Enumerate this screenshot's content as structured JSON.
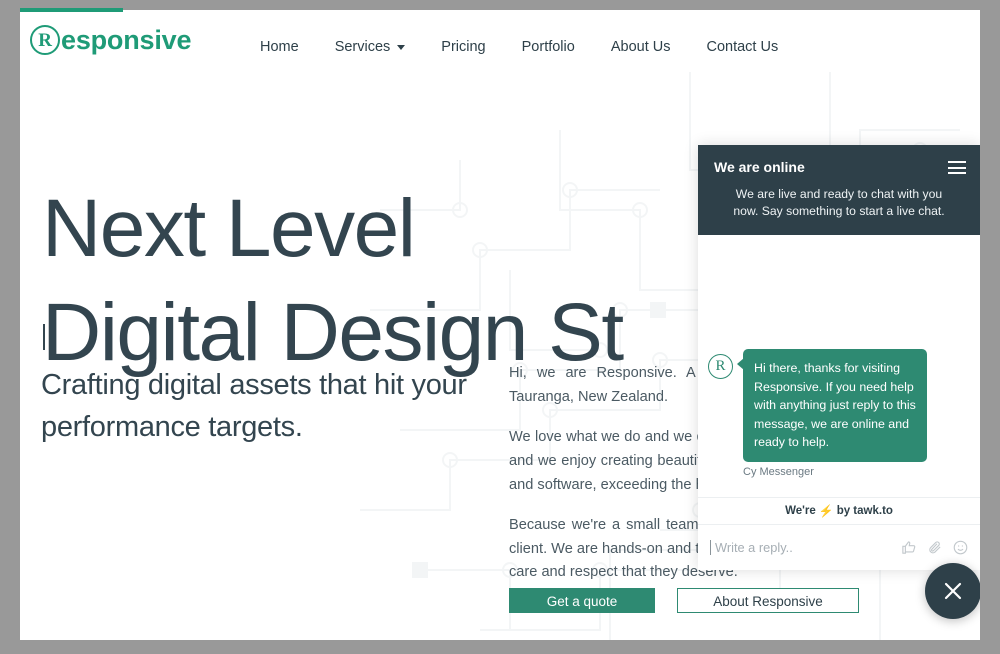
{
  "brand": {
    "logo_mark": "R",
    "logo_word": "esponsive",
    "accent_green": "#1f9b77",
    "dark_slate": "#2e4049",
    "bubble_green": "#2e8a72"
  },
  "nav": {
    "items": [
      {
        "label": "Home",
        "has_caret": false
      },
      {
        "label": "Services",
        "has_caret": true
      },
      {
        "label": "Pricing",
        "has_caret": false
      },
      {
        "label": "Portfolio",
        "has_caret": false
      },
      {
        "label": "About Us",
        "has_caret": false
      },
      {
        "label": "Contact Us",
        "has_caret": false
      }
    ]
  },
  "hero": {
    "line1": "Next Level",
    "line2": "Digital Design St",
    "subheading": "Crafting digital assets that hit your performance targets."
  },
  "copy": {
    "p1": "Hi, we are Responsive. A boutique digital studio based in Tauranga, New Zealand.",
    "p2": "We love what we do and we do it well. Digital media is a passion and we enjoy creating beautiful functional websites, mobile apps and software, exceeding the high expectations of our clients.",
    "p3": "Because we're a small team, we can focus on each and every client. We are hands-on and treat every job, big or small, with the care and respect that they deserve."
  },
  "cta": {
    "primary": "Get a quote",
    "secondary": "About Responsive"
  },
  "chat": {
    "title": "We are online",
    "status": "We are live and ready to chat with you now. Say something to start a live chat.",
    "message": "Hi there, thanks for visiting Responsive. If you need help with anything just reply to this message, we are online and ready to help.",
    "author": "Cy Messenger",
    "avatar_mark": "R",
    "brand_prefix": "We're",
    "brand_bolt": "⚡",
    "brand_suffix": "by tawk.to",
    "input_placeholder": "Write a reply..",
    "icons": [
      "thumbs-up-icon",
      "paperclip-icon",
      "emoji-icon"
    ],
    "menu_icon": "hamburger-icon"
  },
  "fab": {
    "icon": "close-icon"
  }
}
